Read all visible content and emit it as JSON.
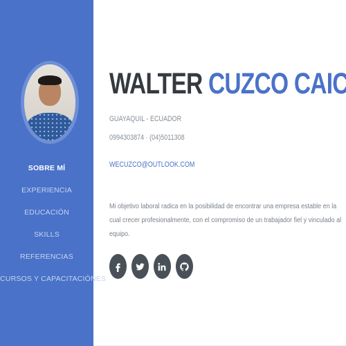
{
  "profile": {
    "first_name": "WALTER",
    "last_name": "CUZCO CAICEDO",
    "location": "GUAYAQUIL - ECUADOR",
    "phone": "0994303874 · (04)5011308",
    "email": "WECUZCO@OUTLOOK.COM",
    "objective": "Mi objetivo laboral radica en la posibilidad de encontrar una empresa estable en la cual crecer profesionalmente, con el compromiso de un trabajador fiel y vinculado al equipo."
  },
  "sidebar": {
    "items": [
      {
        "label": "SOBRE MÍ",
        "active": true
      },
      {
        "label": "EXPERIENCIA",
        "active": false
      },
      {
        "label": "EDUCACIÓN",
        "active": false
      },
      {
        "label": "SKILLS",
        "active": false
      },
      {
        "label": "REFERENCIAS",
        "active": false
      },
      {
        "label": "CURSOS Y CAPACITACIÓNES",
        "active": false
      }
    ]
  },
  "social": [
    {
      "icon": "facebook-icon"
    },
    {
      "icon": "twitter-icon"
    },
    {
      "icon": "linkedin-icon"
    },
    {
      "icon": "github-icon"
    }
  ],
  "colors": {
    "accent": "#4a72c8",
    "dark": "#343a40",
    "muted": "#868e96"
  }
}
